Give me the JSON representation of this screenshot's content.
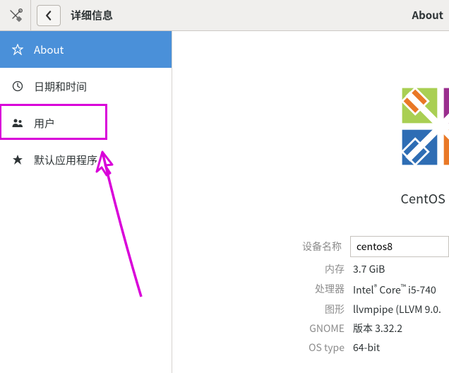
{
  "toolbar": {
    "title": "详细信息",
    "right_label": "About"
  },
  "sidebar": {
    "items": [
      {
        "label": "About",
        "icon": "about-icon",
        "active": true
      },
      {
        "label": "日期和时间",
        "icon": "clock-icon",
        "active": false
      },
      {
        "label": "用户",
        "icon": "users-icon",
        "active": false
      },
      {
        "label": "默认应用程序",
        "icon": "star-icon",
        "active": false
      }
    ]
  },
  "content": {
    "os_name": "CentOS Linux",
    "info": {
      "device_name_label": "设备名称",
      "device_name_value": "centos8",
      "memory_label": "内存",
      "memory_value": "3.7 GiB",
      "processor_label": "处理器",
      "processor_value_prefix": "Intel",
      "processor_value_mid": " Core",
      "processor_value_suffix": " i5-740",
      "graphics_label": "图形",
      "graphics_value": "llvmpipe (LLVM 9.0.",
      "gnome_label": "GNOME",
      "gnome_value": "版本 3.32.2",
      "ostype_label": "OS type",
      "ostype_value": "64-bit"
    }
  }
}
